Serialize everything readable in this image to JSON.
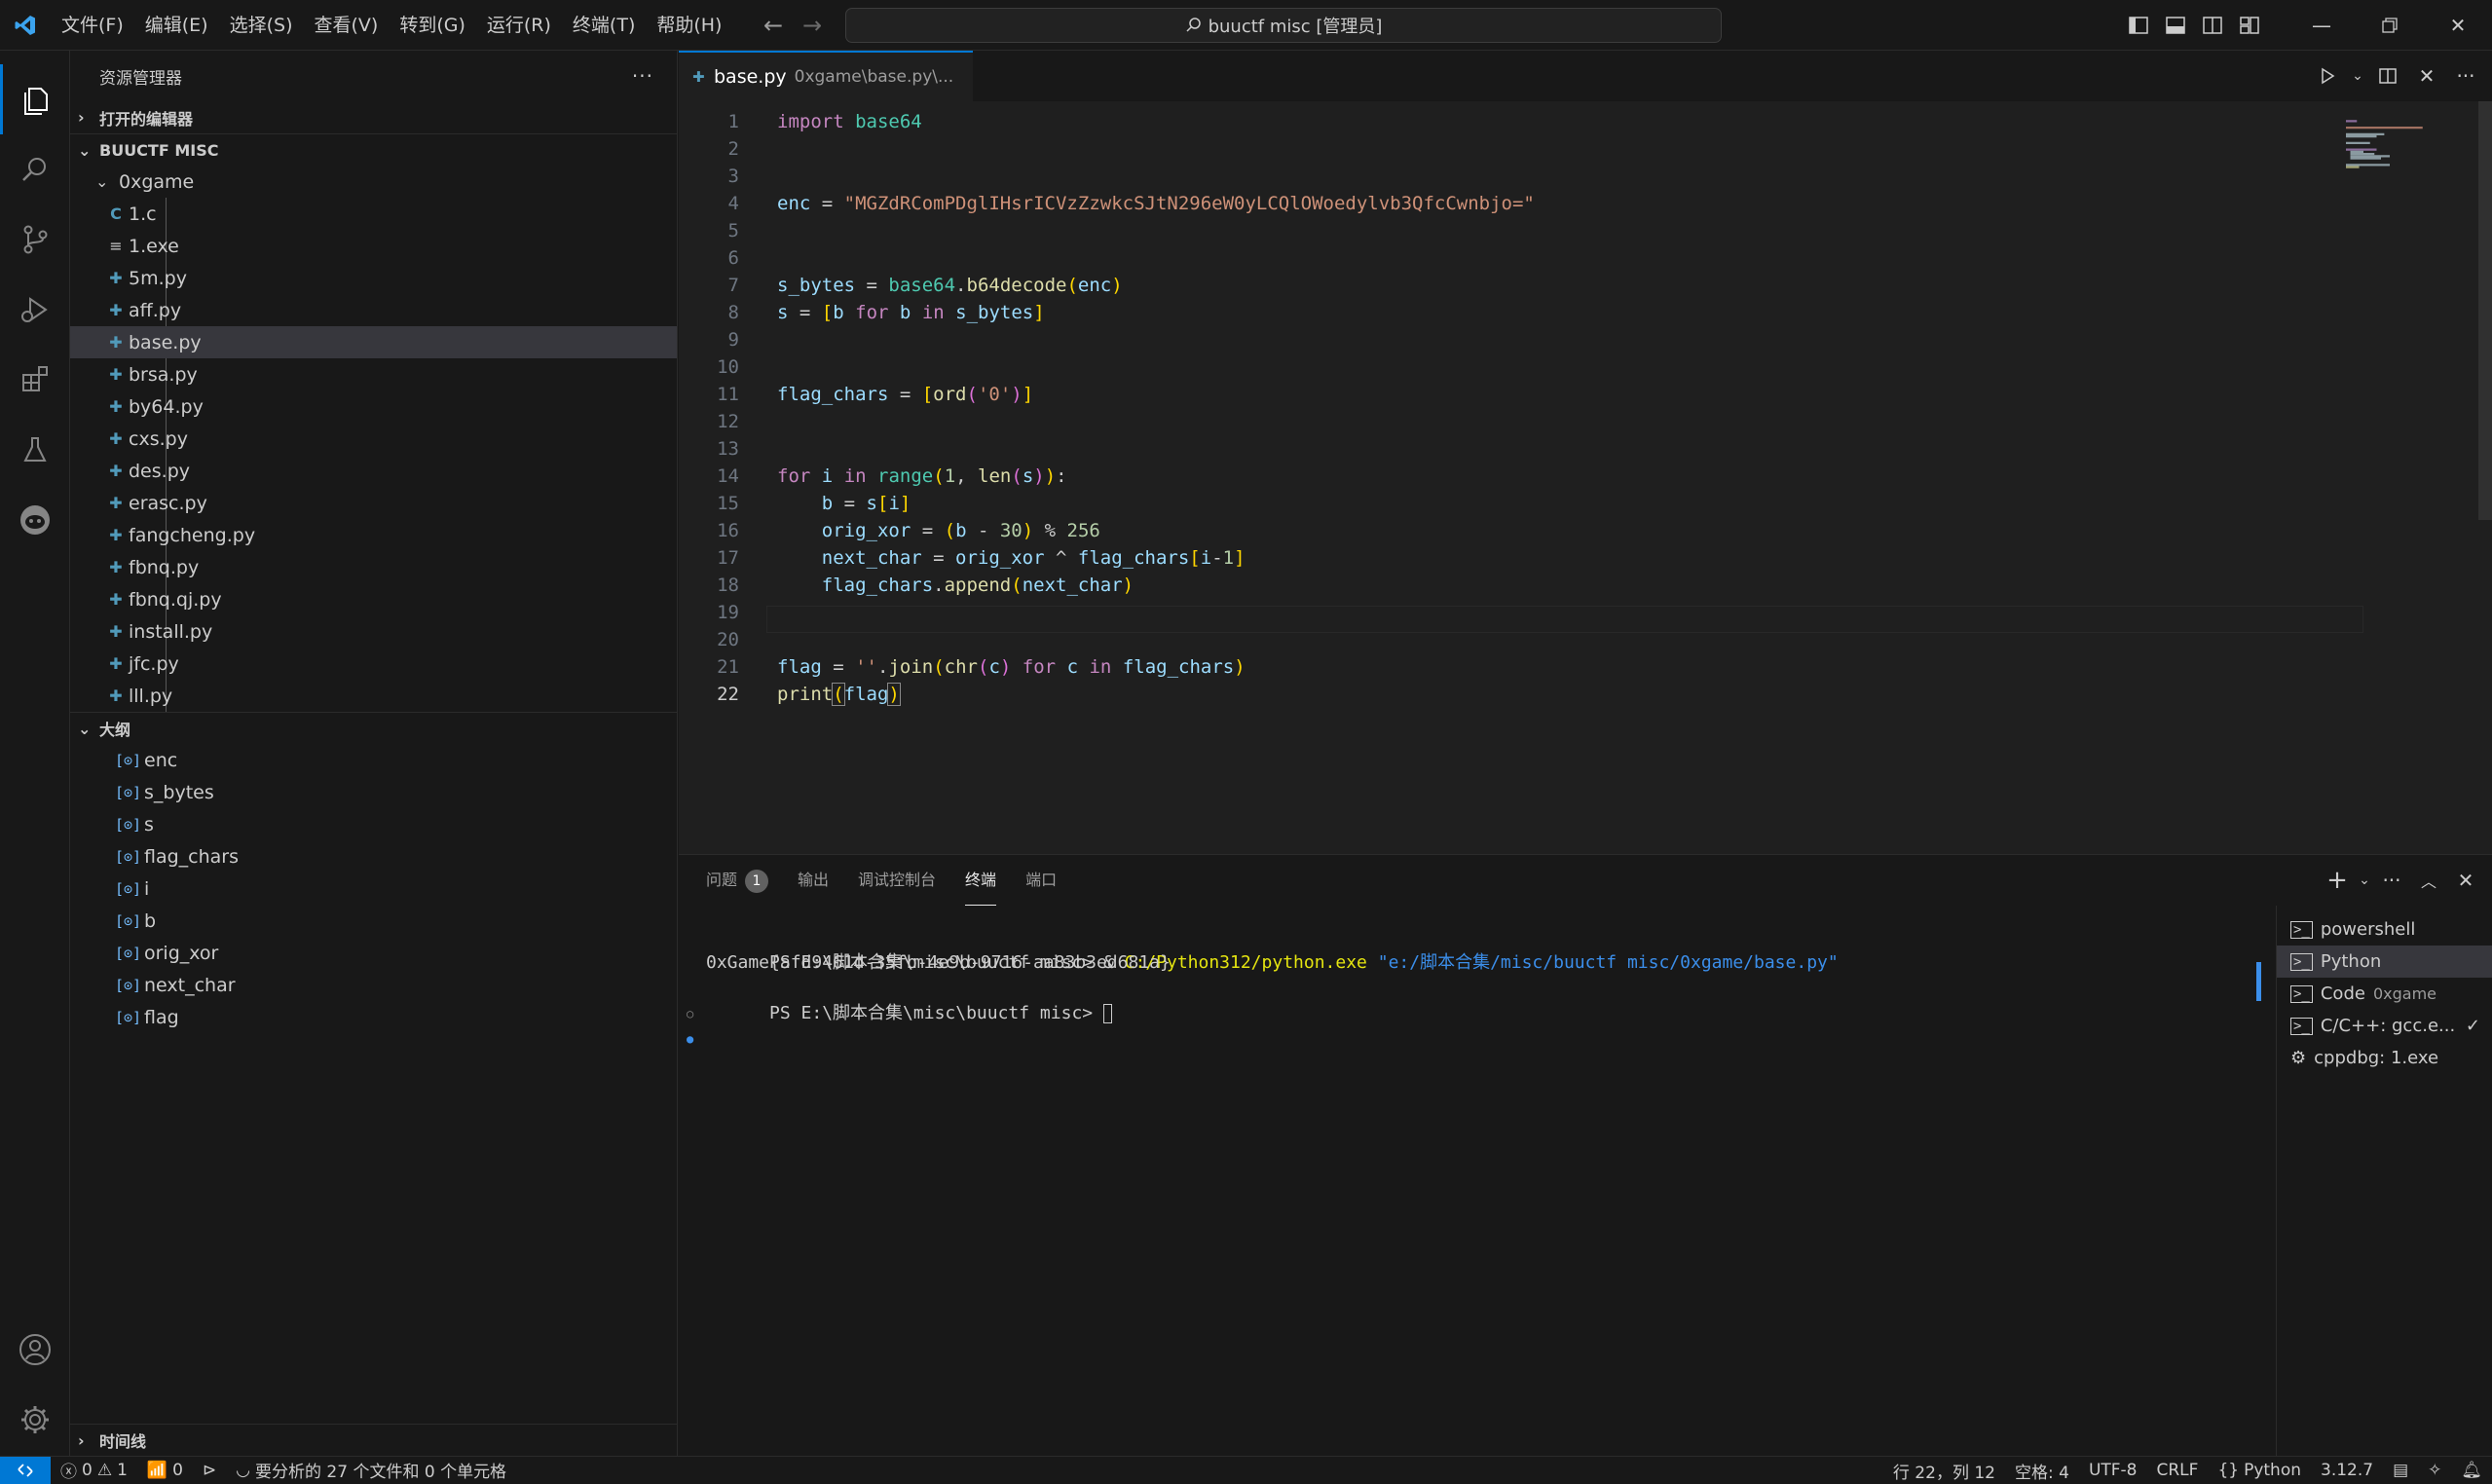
{
  "menu": [
    "文件(F)",
    "编辑(E)",
    "选择(S)",
    "查看(V)",
    "转到(G)",
    "运行(R)",
    "终端(T)",
    "帮助(H)"
  ],
  "command_center": "buuctf misc [管理员]",
  "sidebar": {
    "title": "资源管理器",
    "open_editors": "打开的编辑器",
    "workspace": "BUUCTF MISC",
    "folder": "0xgame",
    "files": [
      "1.c",
      "1.exe",
      "5m.py",
      "aff.py",
      "base.py",
      "brsa.py",
      "by64.py",
      "cxs.py",
      "des.py",
      "erasc.py",
      "fangcheng.py",
      "fbnq.py",
      "fbnq.qj.py",
      "install.py",
      "jfc.py",
      "lll.py"
    ],
    "outline_title": "大纲",
    "outline": [
      "enc",
      "s_bytes",
      "s",
      "flag_chars",
      "i",
      "b",
      "orig_xor",
      "next_char",
      "flag"
    ],
    "timeline": "时间线"
  },
  "editor": {
    "tab_name": "base.py",
    "tab_desc": "0xgame\\base.py\\...",
    "lines": [
      "import base64",
      "",
      "",
      "enc = \"MGZdRComPDglIHsrICVzZzwkcSJtN296eW0yLCQlOWoedylvb3QfcCwnbjo=\"",
      "",
      "",
      "s_bytes = base64.b64decode(enc)",
      "s = [b for b in s_bytes]",
      "",
      "",
      "flag_chars = [ord('0')]",
      "",
      "",
      "for i in range(1, len(s)):",
      "    b = s[i]",
      "    orig_xor = (b - 30) % 256",
      "    next_char = orig_xor ^ flag_chars[i-1]",
      "    flag_chars.append(next_char)",
      "",
      "",
      "flag = ''.join(chr(c) for c in flag_chars)",
      "print(flag)"
    ]
  },
  "panel": {
    "tabs": [
      "问题",
      "输出",
      "调试控制台",
      "终端",
      "端口"
    ],
    "problems_count": "1",
    "terminal_lines": [
      "PS E:\\脚本合集\\misc\\buuctf misc> & C:/Python312/python.exe \"e:/脚本合集/misc/buuctf misc/0xgame/base.py\"",
      "0xGame{afd9461d-35fb-4e9b-9716-aa83b3ed681a}",
      "PS E:\\脚本合集\\misc\\buuctf misc> "
    ],
    "terminals": [
      {
        "name": "powershell",
        "sub": ""
      },
      {
        "name": "Python",
        "sub": ""
      },
      {
        "name": "Code",
        "sub": "0xgame"
      },
      {
        "name": "C/C++: gcc.e...",
        "sub": ""
      },
      {
        "name": "cppdbg: 1.exe",
        "sub": ""
      }
    ]
  },
  "status": {
    "errors": "0",
    "warnings": "1",
    "ports": "0",
    "analysis": "要分析的 27 个文件和 0 个单元格",
    "position": "行 22，列 12",
    "spaces": "空格: 4",
    "encoding": "UTF-8",
    "eol": "CRLF",
    "language": "Python",
    "version": "3.12.7"
  },
  "colors": {
    "accent": "#0078d4",
    "keyword": "#c586c0",
    "string": "#ce9178",
    "function": "#dcdcaa",
    "variable": "#9cdcfe",
    "number": "#b5cea8"
  }
}
